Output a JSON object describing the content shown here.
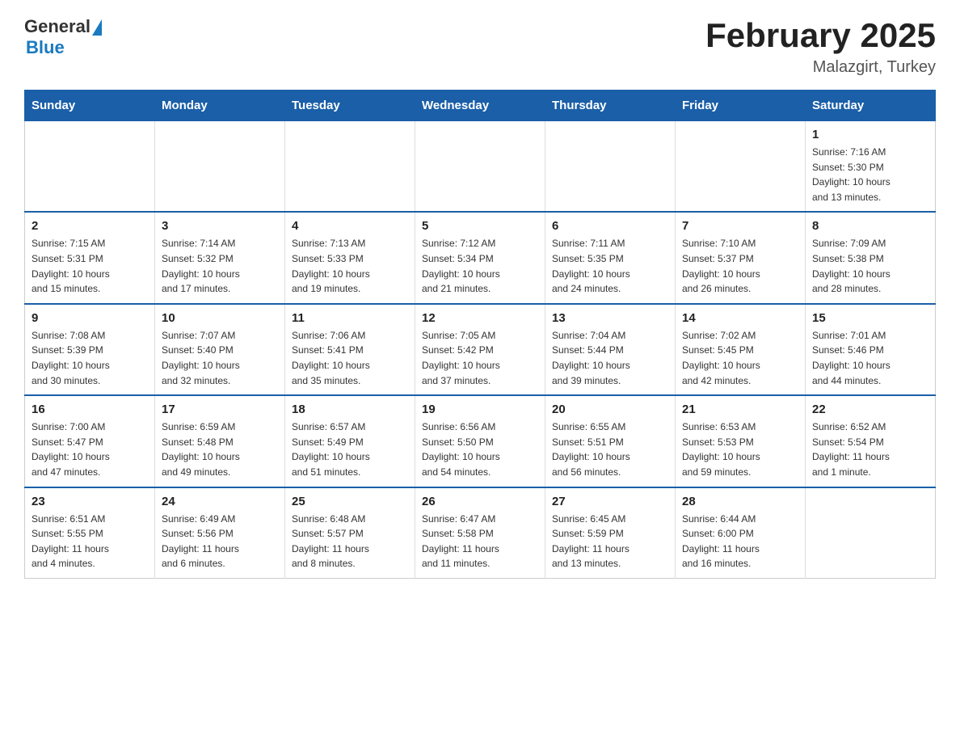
{
  "logo": {
    "general": "General",
    "blue": "Blue"
  },
  "header": {
    "title": "February 2025",
    "subtitle": "Malazgirt, Turkey"
  },
  "weekdays": [
    "Sunday",
    "Monday",
    "Tuesday",
    "Wednesday",
    "Thursday",
    "Friday",
    "Saturday"
  ],
  "weeks": [
    [
      {
        "day": "",
        "info": ""
      },
      {
        "day": "",
        "info": ""
      },
      {
        "day": "",
        "info": ""
      },
      {
        "day": "",
        "info": ""
      },
      {
        "day": "",
        "info": ""
      },
      {
        "day": "",
        "info": ""
      },
      {
        "day": "1",
        "info": "Sunrise: 7:16 AM\nSunset: 5:30 PM\nDaylight: 10 hours\nand 13 minutes."
      }
    ],
    [
      {
        "day": "2",
        "info": "Sunrise: 7:15 AM\nSunset: 5:31 PM\nDaylight: 10 hours\nand 15 minutes."
      },
      {
        "day": "3",
        "info": "Sunrise: 7:14 AM\nSunset: 5:32 PM\nDaylight: 10 hours\nand 17 minutes."
      },
      {
        "day": "4",
        "info": "Sunrise: 7:13 AM\nSunset: 5:33 PM\nDaylight: 10 hours\nand 19 minutes."
      },
      {
        "day": "5",
        "info": "Sunrise: 7:12 AM\nSunset: 5:34 PM\nDaylight: 10 hours\nand 21 minutes."
      },
      {
        "day": "6",
        "info": "Sunrise: 7:11 AM\nSunset: 5:35 PM\nDaylight: 10 hours\nand 24 minutes."
      },
      {
        "day": "7",
        "info": "Sunrise: 7:10 AM\nSunset: 5:37 PM\nDaylight: 10 hours\nand 26 minutes."
      },
      {
        "day": "8",
        "info": "Sunrise: 7:09 AM\nSunset: 5:38 PM\nDaylight: 10 hours\nand 28 minutes."
      }
    ],
    [
      {
        "day": "9",
        "info": "Sunrise: 7:08 AM\nSunset: 5:39 PM\nDaylight: 10 hours\nand 30 minutes."
      },
      {
        "day": "10",
        "info": "Sunrise: 7:07 AM\nSunset: 5:40 PM\nDaylight: 10 hours\nand 32 minutes."
      },
      {
        "day": "11",
        "info": "Sunrise: 7:06 AM\nSunset: 5:41 PM\nDaylight: 10 hours\nand 35 minutes."
      },
      {
        "day": "12",
        "info": "Sunrise: 7:05 AM\nSunset: 5:42 PM\nDaylight: 10 hours\nand 37 minutes."
      },
      {
        "day": "13",
        "info": "Sunrise: 7:04 AM\nSunset: 5:44 PM\nDaylight: 10 hours\nand 39 minutes."
      },
      {
        "day": "14",
        "info": "Sunrise: 7:02 AM\nSunset: 5:45 PM\nDaylight: 10 hours\nand 42 minutes."
      },
      {
        "day": "15",
        "info": "Sunrise: 7:01 AM\nSunset: 5:46 PM\nDaylight: 10 hours\nand 44 minutes."
      }
    ],
    [
      {
        "day": "16",
        "info": "Sunrise: 7:00 AM\nSunset: 5:47 PM\nDaylight: 10 hours\nand 47 minutes."
      },
      {
        "day": "17",
        "info": "Sunrise: 6:59 AM\nSunset: 5:48 PM\nDaylight: 10 hours\nand 49 minutes."
      },
      {
        "day": "18",
        "info": "Sunrise: 6:57 AM\nSunset: 5:49 PM\nDaylight: 10 hours\nand 51 minutes."
      },
      {
        "day": "19",
        "info": "Sunrise: 6:56 AM\nSunset: 5:50 PM\nDaylight: 10 hours\nand 54 minutes."
      },
      {
        "day": "20",
        "info": "Sunrise: 6:55 AM\nSunset: 5:51 PM\nDaylight: 10 hours\nand 56 minutes."
      },
      {
        "day": "21",
        "info": "Sunrise: 6:53 AM\nSunset: 5:53 PM\nDaylight: 10 hours\nand 59 minutes."
      },
      {
        "day": "22",
        "info": "Sunrise: 6:52 AM\nSunset: 5:54 PM\nDaylight: 11 hours\nand 1 minute."
      }
    ],
    [
      {
        "day": "23",
        "info": "Sunrise: 6:51 AM\nSunset: 5:55 PM\nDaylight: 11 hours\nand 4 minutes."
      },
      {
        "day": "24",
        "info": "Sunrise: 6:49 AM\nSunset: 5:56 PM\nDaylight: 11 hours\nand 6 minutes."
      },
      {
        "day": "25",
        "info": "Sunrise: 6:48 AM\nSunset: 5:57 PM\nDaylight: 11 hours\nand 8 minutes."
      },
      {
        "day": "26",
        "info": "Sunrise: 6:47 AM\nSunset: 5:58 PM\nDaylight: 11 hours\nand 11 minutes."
      },
      {
        "day": "27",
        "info": "Sunrise: 6:45 AM\nSunset: 5:59 PM\nDaylight: 11 hours\nand 13 minutes."
      },
      {
        "day": "28",
        "info": "Sunrise: 6:44 AM\nSunset: 6:00 PM\nDaylight: 11 hours\nand 16 minutes."
      },
      {
        "day": "",
        "info": ""
      }
    ]
  ]
}
